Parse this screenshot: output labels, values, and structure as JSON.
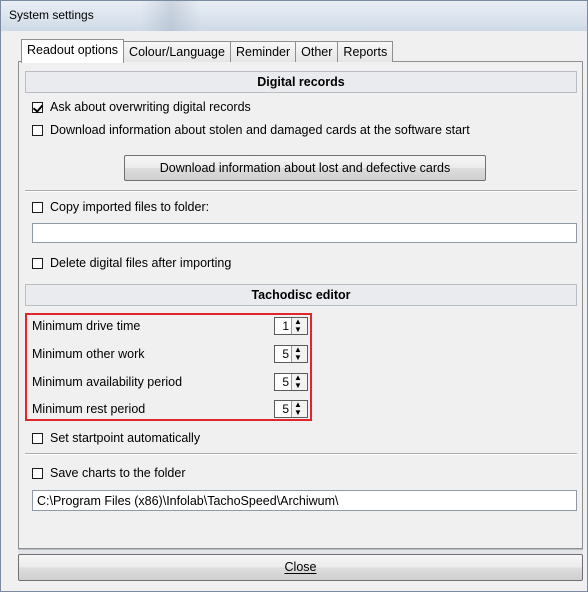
{
  "window": {
    "title": "System settings"
  },
  "tabs": [
    {
      "label": "Readout options",
      "active": true
    },
    {
      "label": "Colour/Language",
      "active": false
    },
    {
      "label": "Reminder",
      "active": false
    },
    {
      "label": "Other",
      "active": false
    },
    {
      "label": "Reports",
      "active": false
    }
  ],
  "digital": {
    "header": "Digital records",
    "ask_overwrite": {
      "label": "Ask about overwriting digital records",
      "checked": true
    },
    "download_stolen": {
      "label": "Download information about stolen and damaged cards at the software start",
      "checked": false
    },
    "download_button": "Download information about lost and defective cards",
    "copy_files": {
      "label": "Copy imported files to folder:",
      "checked": false,
      "path": ""
    },
    "delete_files": {
      "label": "Delete digital files after importing",
      "checked": false
    }
  },
  "tachodisc": {
    "header": "Tachodisc editor",
    "fields": [
      {
        "label": "Minimum drive time",
        "value": "1"
      },
      {
        "label": "Minimum other work",
        "value": "5"
      },
      {
        "label": "Minimum availability period",
        "value": "5"
      },
      {
        "label": "Minimum rest period",
        "value": "5"
      }
    ],
    "startpoint": {
      "label": "Set startpoint automatically",
      "checked": false
    },
    "save_charts": {
      "label": "Save charts to the folder",
      "checked": false,
      "path": "C:\\Program Files (x86)\\Infolab\\TachoSpeed\\Archiwum\\"
    }
  },
  "footer": {
    "close_label": "Close"
  },
  "highlight_color": "#e0262b"
}
